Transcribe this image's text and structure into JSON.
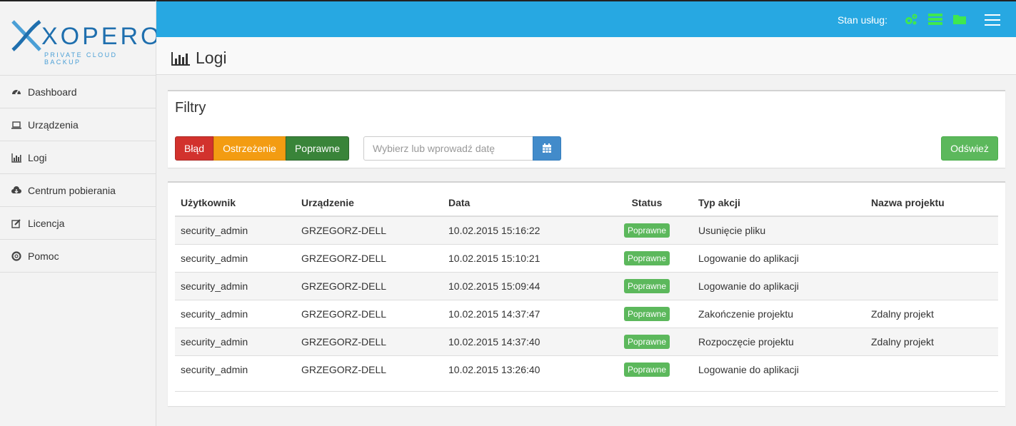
{
  "app": {
    "logo_text": "XOPERO",
    "logo_sub": "PRIVATE CLOUD BACKUP"
  },
  "colors": {
    "topbar": "#27a8e2",
    "danger": "#d2322d",
    "warning": "#f39c12",
    "success": "#5cb85c",
    "primary": "#428bca",
    "status_icons": "#3fe84f"
  },
  "sidebar": {
    "items": [
      {
        "label": "Dashboard",
        "icon": "dashboard-icon"
      },
      {
        "label": "Urządzenia",
        "icon": "laptop-icon"
      },
      {
        "label": "Logi",
        "icon": "bar-chart-icon"
      },
      {
        "label": "Centrum pobierania",
        "icon": "cloud-download-icon"
      },
      {
        "label": "Licencja",
        "icon": "edit-icon"
      },
      {
        "label": "Pomoc",
        "icon": "lifebuoy-icon"
      }
    ]
  },
  "topbar": {
    "service_label": "Stan usług:",
    "service_icons": [
      "gears-icon",
      "server-icon",
      "folder-icon"
    ]
  },
  "page": {
    "title": "Logi"
  },
  "filters": {
    "title": "Filtry",
    "btn_error": "Błąd",
    "btn_warning": "Ostrzeżenie",
    "btn_ok": "Poprawne",
    "date_placeholder": "Wybierz lub wprowadź datę",
    "refresh_label": "Odśwież"
  },
  "table": {
    "headers": [
      "Użytkownik",
      "Urządzenie",
      "Data",
      "Status",
      "Typ akcji",
      "Nazwa projektu"
    ],
    "rows": [
      {
        "user": "security_admin",
        "device": "GRZEGORZ-DELL",
        "date": "10.02.2015 15:16:22",
        "status": "Poprawne",
        "action": "Usunięcie pliku",
        "project": ""
      },
      {
        "user": "security_admin",
        "device": "GRZEGORZ-DELL",
        "date": "10.02.2015 15:10:21",
        "status": "Poprawne",
        "action": "Logowanie do aplikacji",
        "project": ""
      },
      {
        "user": "security_admin",
        "device": "GRZEGORZ-DELL",
        "date": "10.02.2015 15:09:44",
        "status": "Poprawne",
        "action": "Logowanie do aplikacji",
        "project": ""
      },
      {
        "user": "security_admin",
        "device": "GRZEGORZ-DELL",
        "date": "10.02.2015 14:37:47",
        "status": "Poprawne",
        "action": "Zakończenie projektu",
        "project": "Zdalny projekt"
      },
      {
        "user": "security_admin",
        "device": "GRZEGORZ-DELL",
        "date": "10.02.2015 14:37:40",
        "status": "Poprawne",
        "action": "Rozpoczęcie projektu",
        "project": "Zdalny projekt"
      },
      {
        "user": "security_admin",
        "device": "GRZEGORZ-DELL",
        "date": "10.02.2015 13:26:40",
        "status": "Poprawne",
        "action": "Logowanie do aplikacji",
        "project": ""
      }
    ]
  }
}
